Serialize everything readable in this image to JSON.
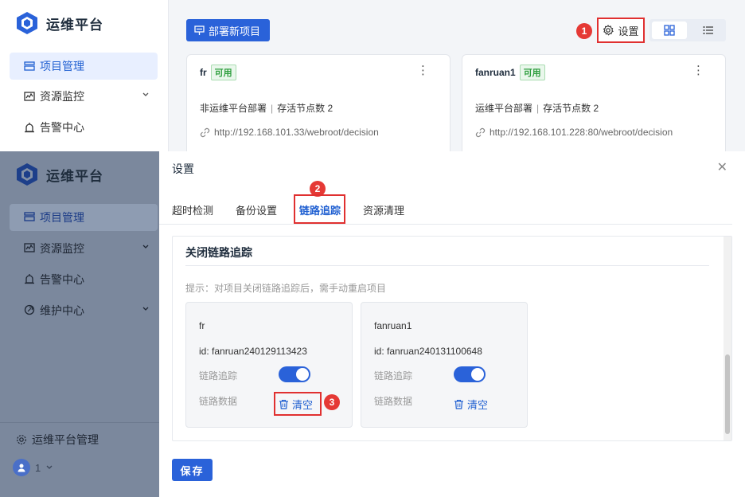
{
  "app": {
    "name": "运维平台"
  },
  "sidebar": {
    "items": [
      {
        "label": "项目管理",
        "icon": "project-icon",
        "active": true
      },
      {
        "label": "资源监控",
        "icon": "monitor-icon",
        "expandable": true
      },
      {
        "label": "告警中心",
        "icon": "alarm-icon"
      },
      {
        "label": "维护中心",
        "icon": "maintenance-icon",
        "expandable": true
      }
    ],
    "footer": {
      "manage_label": "运维平台管理",
      "user_label": "1"
    }
  },
  "toolbar": {
    "deploy_label": "部署新项目",
    "settings_label": "设置"
  },
  "projects": [
    {
      "name": "fr",
      "status": "可用",
      "type": "非运维平台部署",
      "nodes_label": "存活节点数",
      "nodes": "2",
      "url": "http://192.168.101.33/webroot/decision"
    },
    {
      "name": "fanruan1",
      "status": "可用",
      "type": "运维平台部署",
      "nodes_label": "存活节点数",
      "nodes": "2",
      "url": "http://192.168.101.228:80/webroot/decision"
    }
  ],
  "modal": {
    "title": "设置",
    "tabs": [
      "超时检测",
      "备份设置",
      "链路追踪",
      "资源清理"
    ],
    "active_tab": "链路追踪",
    "section_title": "关闭链路追踪",
    "hint": "提示：对项目关闭链路追踪后，需手动重启项目",
    "trace_cards": [
      {
        "name": "fr",
        "id_text": "id: fanruan240129113423",
        "trace_label": "链路追踪",
        "trace_on": true,
        "data_label": "链路数据",
        "clear_label": "清空"
      },
      {
        "name": "fanruan1",
        "id_text": "id: fanruan240131100648",
        "trace_label": "链路追踪",
        "trace_on": true,
        "data_label": "链路数据",
        "clear_label": "清空"
      }
    ],
    "save_label": "保存"
  },
  "annotations": [
    "1",
    "2",
    "3"
  ],
  "colors": {
    "primary": "#2a62d9",
    "highlight": "#e03030",
    "status_ok": "#2e9e3e",
    "overlay": "#7b889d"
  }
}
